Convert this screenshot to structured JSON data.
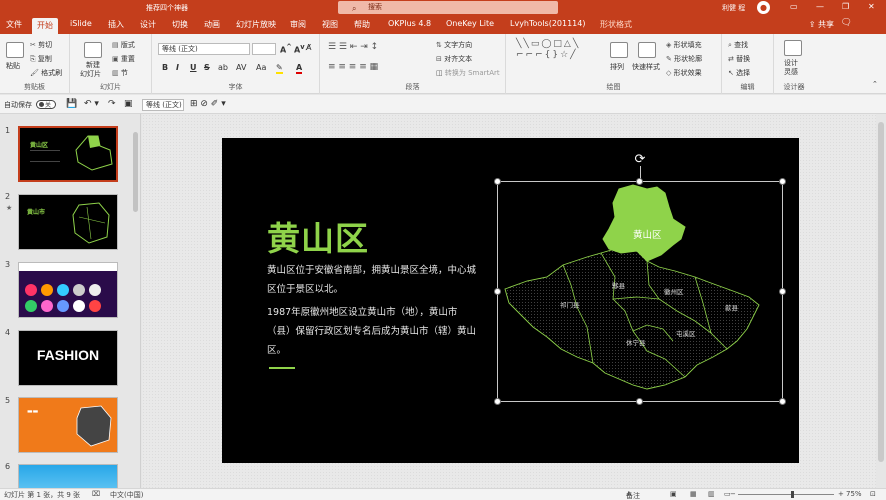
{
  "titlebar": {
    "doc_name": "推荐四个神器",
    "search_placeholder": "搜索",
    "user": "利健 程",
    "avatar_initial": "👤",
    "min": "—",
    "restore": "❐",
    "close": "✕"
  },
  "tabs": [
    "文件",
    "开始",
    "iSlide",
    "插入",
    "设计",
    "切换",
    "动画",
    "幻灯片放映",
    "审阅",
    "视图",
    "帮助",
    "OKPlus 4.8",
    "OneKey Lite",
    "LvyhTools(201114)",
    "形状格式"
  ],
  "active_tab_index": 1,
  "share": "共享",
  "ribbon": {
    "clipboard": {
      "label": "剪贴板",
      "paste": "粘贴",
      "cut": "剪切",
      "copy": "复制",
      "format_painter": "格式刷"
    },
    "slides": {
      "label": "幻灯片",
      "new_slide": "新建",
      "new_slide2": "幻灯片",
      "layout": "版式",
      "reset": "重置",
      "section": "节"
    },
    "font": {
      "label": "字体",
      "font_name": "等线 (正文)",
      "font_size": "",
      "bold": "B",
      "italic": "I",
      "underline": "U",
      "strike": "S",
      "shadow": "ab",
      "spacing": "AV",
      "case": "Aa"
    },
    "paragraph": {
      "label": "段落",
      "text_direction": "文字方向",
      "align_text": "对齐文本",
      "smartart": "转换为 SmartArt"
    },
    "drawing": {
      "label": "绘图",
      "arrange": "排列",
      "quick_styles": "快速样式",
      "fill": "形状填充",
      "outline": "形状轮廓",
      "effects": "形状效果"
    },
    "editing": {
      "label": "编辑",
      "find": "查找",
      "replace": "替换",
      "select": "选择"
    },
    "designer": {
      "label": "设计器",
      "btn": "设计",
      "btn2": "灵感"
    }
  },
  "qat": {
    "autosave": "自动保存",
    "autosave_state": "关",
    "font": "等线 (正文)"
  },
  "thumbnails": [
    {
      "num": "1",
      "star": ""
    },
    {
      "num": "2",
      "star": "★"
    },
    {
      "num": "3",
      "star": ""
    },
    {
      "num": "4",
      "star": "",
      "text": "FASHION"
    },
    {
      "num": "5",
      "star": ""
    },
    {
      "num": "6",
      "star": ""
    }
  ],
  "slide": {
    "title": "黄山区",
    "para1": "黄山区位于安徽省南部，拥黄山景区全境，中心城区位于景区以北。",
    "para2": "1987年原徽州地区设立黄山市（地），黄山市（县）保留行政区划专名后成为黄山市（辖）黄山区。",
    "map_labels": {
      "huangshan": "黄山区",
      "qimen": "祁门县",
      "yixian": "黟县",
      "huizhou": "徽州区",
      "shexian": "歙县",
      "tunxi": "屯溪区",
      "xiuning": "休宁县"
    },
    "accent_color": "#8fd34a"
  },
  "status": {
    "slide_info": "幻灯片 第 1 张，共 9 张",
    "language": "中文(中国)",
    "notes": "备注",
    "zoom": "75%"
  }
}
